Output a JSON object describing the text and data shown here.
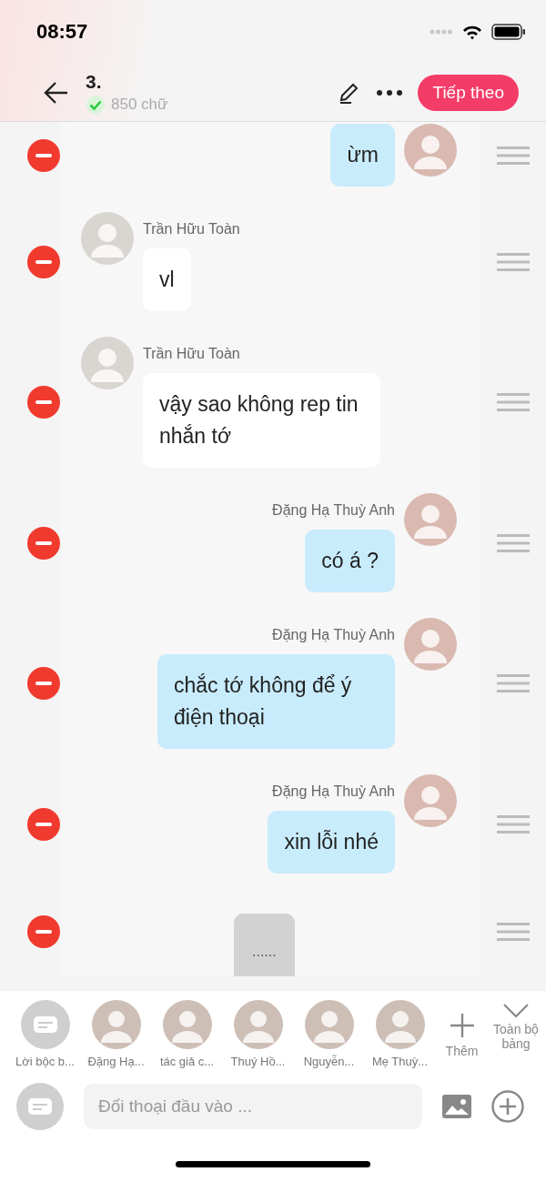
{
  "status_bar": {
    "time": "08:57"
  },
  "header": {
    "title": "3.",
    "word_count": "850 chữ",
    "saved": true,
    "next_button": "Tiếp theo"
  },
  "messages": [
    {
      "kind": "outgoing",
      "text": "ừm"
    },
    {
      "kind": "incoming",
      "name": "Trần Hữu Toàn",
      "text": "vl"
    },
    {
      "kind": "incoming",
      "name": "Trần Hữu Toàn",
      "text": "vậy sao không rep tin nhắn tớ"
    },
    {
      "kind": "outgoing",
      "name": "Đặng Hạ Thuỳ Anh",
      "text": "có á ?"
    },
    {
      "kind": "outgoing",
      "name": "Đặng Hạ Thuỳ Anh",
      "text": "chắc tớ không để ý điện thoại"
    },
    {
      "kind": "outgoing",
      "name": "Đặng Hạ Thuỳ Anh",
      "text": "xin lỗi nhé"
    },
    {
      "kind": "narration",
      "text": "......"
    }
  ],
  "characters": [
    {
      "kind": "narration",
      "name": "Lời bộc b..."
    },
    {
      "kind": "person",
      "name": "Đặng Hạ..."
    },
    {
      "kind": "person",
      "name": "tác giả c..."
    },
    {
      "kind": "person",
      "name": "Thuý Hồ..."
    },
    {
      "kind": "person",
      "name": "Nguyễn..."
    },
    {
      "kind": "person",
      "name": "Mẹ Thuỳ..."
    }
  ],
  "add_button": "Thêm",
  "expand_button": "Toàn bộ bảng",
  "input": {
    "placeholder": "Đối thoại đầu vào ..."
  }
}
